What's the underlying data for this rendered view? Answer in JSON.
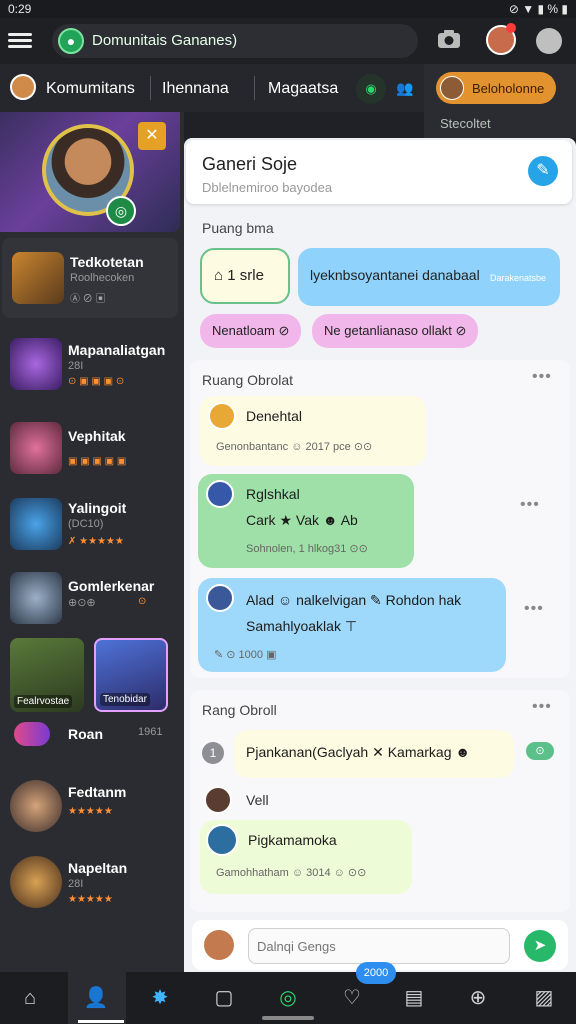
{
  "status": {
    "time": "0:29",
    "right": "⊘ ▼ ▮ %  ▮"
  },
  "app": {
    "title": "Domunitais Gananes)"
  },
  "tabs": [
    "Komumitans",
    "Ihennana",
    "Magaatsa"
  ],
  "right_col": {
    "pill": "Beloholonne",
    "stat": "Stecoltet"
  },
  "sidebar": {
    "items": [
      {
        "name": "Tedkotetan",
        "sub": "Roolhecoken",
        "meta": "Ⓐ ⊘   ▣"
      },
      {
        "name": "Mapanaliatgan",
        "sub": "28I",
        "meta": "⊙ ▣ ▣ ▣ ⊙"
      },
      {
        "name": "Vephitak",
        "sub": "",
        "meta": "▣ ▣ ▣ ▣ ▣"
      },
      {
        "name": "Yalingoit",
        "sub": "(DC10)",
        "meta": "✗ ★★★★★"
      },
      {
        "name": "Gomlerkenar",
        "sub": "⊕⊙⊕",
        "meta": "⊙"
      }
    ],
    "cards": [
      {
        "cap": "Fealrvostae"
      },
      {
        "cap": "Tenobidar"
      }
    ],
    "people": [
      {
        "name": "Roan",
        "meta": "1961"
      },
      {
        "name": "Fedtanm",
        "meta": "★★★★★"
      },
      {
        "name": "Napeltan",
        "sub": "28I",
        "meta": "★★★★★"
      }
    ]
  },
  "panel": {
    "title": "Ganeri Soje",
    "subtitle": "Dblelnemiroo bayodea",
    "section1": "Puang bma",
    "chips": {
      "a": "⌂ 1 srle",
      "b": "lyeknbsoyantanei danabaal",
      "b_meta": "Darakenatsbe",
      "c": "Nenatloam ⊘",
      "d": "Ne getanlianaso ollakt ⊘"
    },
    "section2": "Ruang Obrolat",
    "msg1": {
      "title": "Denehtal",
      "meta": "Genonbantanc ☺ 2017 pce ⊙⊙"
    },
    "msg2": {
      "title": "Rglshkal",
      "body": "Cark ★ Vak ☻ Ab",
      "meta": "Sohnolen, 1 hlkog31 ⊙⊙"
    },
    "msg3": {
      "line1": "Alad ☺ nalkelvigan ✎ Rohdon hak",
      "line2": "Samahlyoaklak ⊤",
      "meta": "✎ ⊙  1000 ▣"
    },
    "section3": "Rang Obroll",
    "msg4": {
      "title": "Pjankanan(Gaclyah ✕ Kamarkag ☻",
      "meta": "⊙"
    },
    "msg5": {
      "label": "Vell"
    },
    "msg6": {
      "title": "Pigkamamoka",
      "meta": "Gamohhatham ☺ 3014 ☺  ⊙⊙"
    },
    "composer_placeholder": "Dalnqi Gengs"
  },
  "nav": {
    "badge": "2000"
  }
}
